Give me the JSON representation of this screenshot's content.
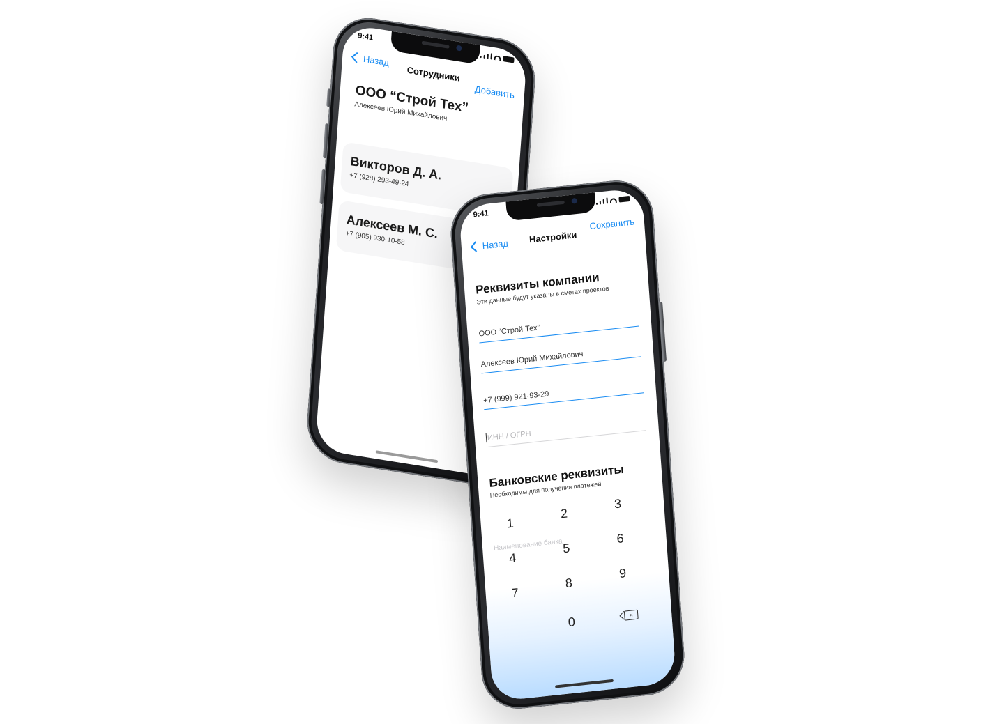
{
  "phone_employees": {
    "status_time": "9:41",
    "nav": {
      "back_label": "Назад",
      "title": "Сотрудники",
      "action_label": "Добавить"
    },
    "company": {
      "name": "ООО “Строй Тех”",
      "owner": "Алексеев Юрий Михайлович"
    },
    "employees": [
      {
        "name": "Викторов Д. А.",
        "phone": "+7 (928) 293-49-24"
      },
      {
        "name": "Алексеев М. С.",
        "phone": "+7 (905) 930-10-58"
      }
    ]
  },
  "phone_settings": {
    "status_time": "9:41",
    "nav": {
      "back_label": "Назад",
      "title": "Настройки",
      "action_label": "Сохранить"
    },
    "company_section": {
      "title": "Реквизиты компании",
      "subtitle": "Эти данные будут указаны в сметах проектов"
    },
    "fields": {
      "company_name": "ООО “Строй Тех”",
      "owner": "Алексеев Юрий Михайлович",
      "phone": "+7 (999) 921-93-29",
      "inn_placeholder": "ИНН / ОГРН"
    },
    "bank_section": {
      "title": "Банковские реквизиты",
      "subtitle": "Необходимы для получения платежей"
    },
    "bank_name_placeholder": "Наименование банка",
    "keypad": [
      "1",
      "2",
      "3",
      "4",
      "5",
      "6",
      "7",
      "8",
      "9",
      "0"
    ]
  },
  "colors": {
    "accent": "#1a8cf2",
    "frame": "#1c1d20"
  }
}
